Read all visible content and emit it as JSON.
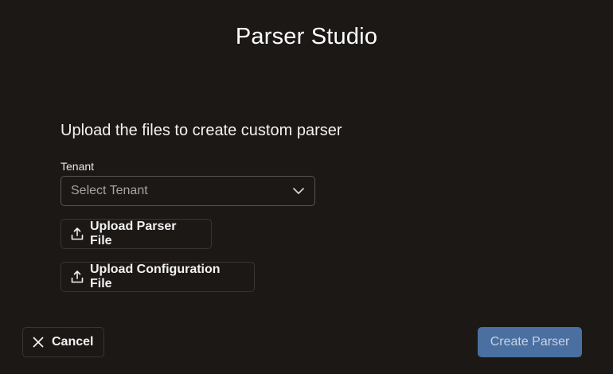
{
  "header": {
    "title": "Parser Studio"
  },
  "form": {
    "subtitle": "Upload the files to create custom parser",
    "tenant": {
      "label": "Tenant",
      "placeholder": "Select Tenant",
      "icon": "chevron-down-icon"
    },
    "upload_parser": {
      "label": "Upload Parser File",
      "icon": "upload-icon"
    },
    "upload_config": {
      "label": "Upload Configuration File",
      "icon": "upload-icon"
    }
  },
  "footer": {
    "cancel": {
      "label": "Cancel",
      "icon": "close-icon"
    },
    "create": {
      "label": "Create Parser",
      "disabled_color": "#4a6fa1"
    }
  },
  "colors": {
    "background": "#1c1816",
    "accent": "#4a6fa1"
  }
}
